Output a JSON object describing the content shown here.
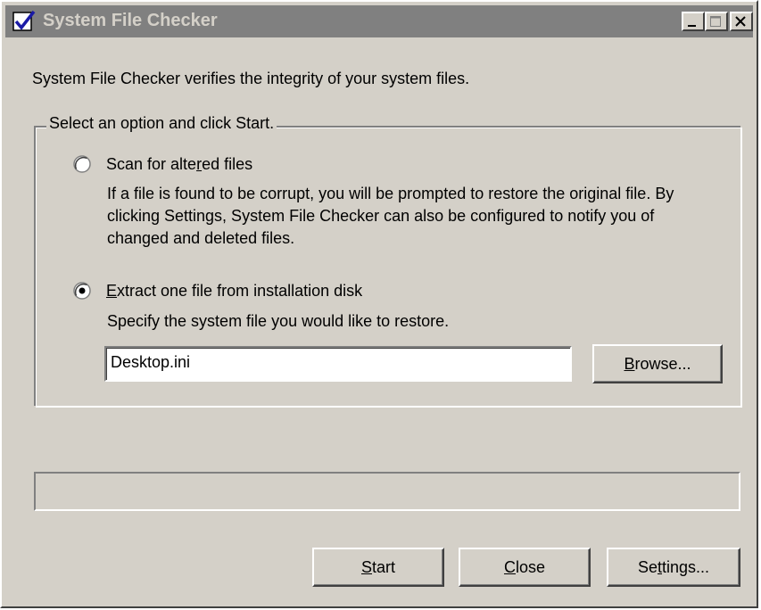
{
  "window": {
    "title": "System File Checker",
    "accent_inactive_titlebar": "#808080",
    "face_color": "#d4d0c8"
  },
  "dialog": {
    "description": "System File Checker verifies the integrity of your system files.",
    "group_label": "Select an option and click Start.",
    "options": [
      {
        "pre": "Scan for alte",
        "accel": "r",
        "post": "ed files",
        "selected": false,
        "help": "If a file is found to be corrupt, you will be prompted to restore the original file. By clicking Settings, System File Checker can also be configured to notify you of changed and deleted files."
      },
      {
        "pre": "",
        "accel": "E",
        "post": "xtract one file from installation disk",
        "selected": true,
        "help": "Specify the system file you would like to restore."
      }
    ],
    "file_input": {
      "value": "Desktop.ini"
    },
    "browse": {
      "accel": "B",
      "rest": "rowse..."
    },
    "progress": {
      "value": 0
    }
  },
  "buttons": {
    "start": {
      "accel": "S",
      "rest": "tart"
    },
    "close": {
      "accel": "C",
      "rest": "lose"
    },
    "settings": {
      "pre": "Se",
      "accel": "t",
      "post": "tings..."
    }
  },
  "icons": [
    "checkmark-app-icon",
    "minimize-icon",
    "maximize-icon",
    "close-icon"
  ]
}
